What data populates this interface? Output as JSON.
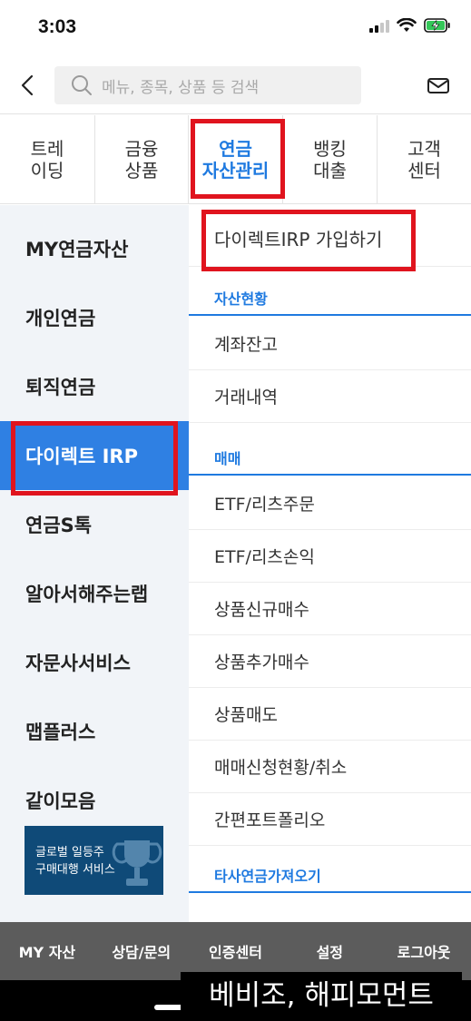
{
  "status_bar": {
    "time": "3:03"
  },
  "search": {
    "placeholder": "메뉴, 종목, 상품 등 검색"
  },
  "tabs": [
    {
      "label": "트레\n이딩",
      "active": false
    },
    {
      "label": "금융\n상품",
      "active": false
    },
    {
      "label": "연금\n자산관리",
      "active": true
    },
    {
      "label": "뱅킹\n대출",
      "active": false
    },
    {
      "label": "고객\n센터",
      "active": false
    }
  ],
  "sidebar": {
    "items": [
      {
        "label": "MY연금자산"
      },
      {
        "label": "개인연금"
      },
      {
        "label": "퇴직연금"
      },
      {
        "label": "다이렉트 IRP",
        "active": true
      },
      {
        "label": "연금S톡"
      },
      {
        "label": "알아서해주는랩"
      },
      {
        "label": "자문사서비스"
      },
      {
        "label": "맵플러스"
      },
      {
        "label": "같이모음"
      }
    ],
    "banner": {
      "text": "글로벌 일등주\n구매대행 서비스"
    }
  },
  "menu": {
    "top_item": "다이렉트IRP 가입하기",
    "sections": [
      {
        "header": "자산현황",
        "items": [
          "계좌잔고",
          "거래내역"
        ]
      },
      {
        "header": "매매",
        "items": [
          "ETF/리츠주문",
          "ETF/리츠손익",
          "상품신규매수",
          "상품추가매수",
          "상품매도",
          "매매신청현황/취소",
          "간편포트폴리오"
        ]
      },
      {
        "header": "타사연금가져오기",
        "items": []
      }
    ]
  },
  "bottom_bar": {
    "items": [
      "MY 자산",
      "상담/문의",
      "인증센터",
      "설정",
      "로그아웃"
    ]
  },
  "watermark": "베비조, 해피모먼트",
  "colors": {
    "accent": "#1f7ae0",
    "active_bg": "#2f80e3",
    "highlight": "#e0141e",
    "sidebar_bg": "#f1f4f8",
    "bottom_bar": "#5c5c5c"
  }
}
